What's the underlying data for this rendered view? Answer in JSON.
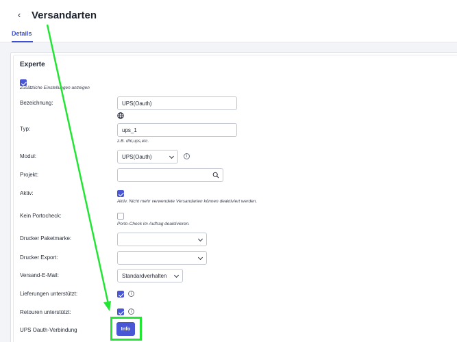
{
  "header": {
    "title": "Versandarten",
    "back_icon": "chevron-left-icon"
  },
  "tabs": [
    {
      "label": "Details",
      "active": true
    }
  ],
  "section": {
    "title": "Experte",
    "extra_settings": {
      "checked": true,
      "label": "Zusätzliche Einstellungen anzeigen"
    }
  },
  "fields": {
    "bezeichnung": {
      "label": "Bezeichnung:",
      "value": "UPS(Oauth)",
      "icon": "globe-icon"
    },
    "typ": {
      "label": "Typ:",
      "value": "ups_1",
      "hint": "z.B. dhl,ups,etc."
    },
    "modul": {
      "label": "Modul:",
      "value": "UPS(Oauth)",
      "icon": "info-icon"
    },
    "projekt": {
      "label": "Projekt:",
      "value": "",
      "icon": "search-icon"
    },
    "aktiv": {
      "label": "Aktiv:",
      "checked": true,
      "hint": "Aktiv. Nicht mehr verwendete Versandarten können deaktiviert werden."
    },
    "kein_portocheck": {
      "label": "Kein Portocheck:",
      "checked": false,
      "hint": "Porto-Check im Auftrag deaktivieren."
    },
    "drucker_paketmarke": {
      "label": "Drucker Paketmarke:",
      "value": ""
    },
    "drucker_export": {
      "label": "Drucker Export:",
      "value": ""
    },
    "versand_email": {
      "label": "Versand-E-Mail:",
      "value": "Standardverhalten"
    },
    "lieferungen": {
      "label": "Lieferungen unterstützt:",
      "checked": true
    },
    "retouren": {
      "label": "Retouren unterstützt:",
      "checked": true
    },
    "ups_oauth": {
      "label": "UPS Oauth-Verbindung",
      "button_label": "Info"
    }
  },
  "annotation": {
    "color": "#22e533"
  }
}
